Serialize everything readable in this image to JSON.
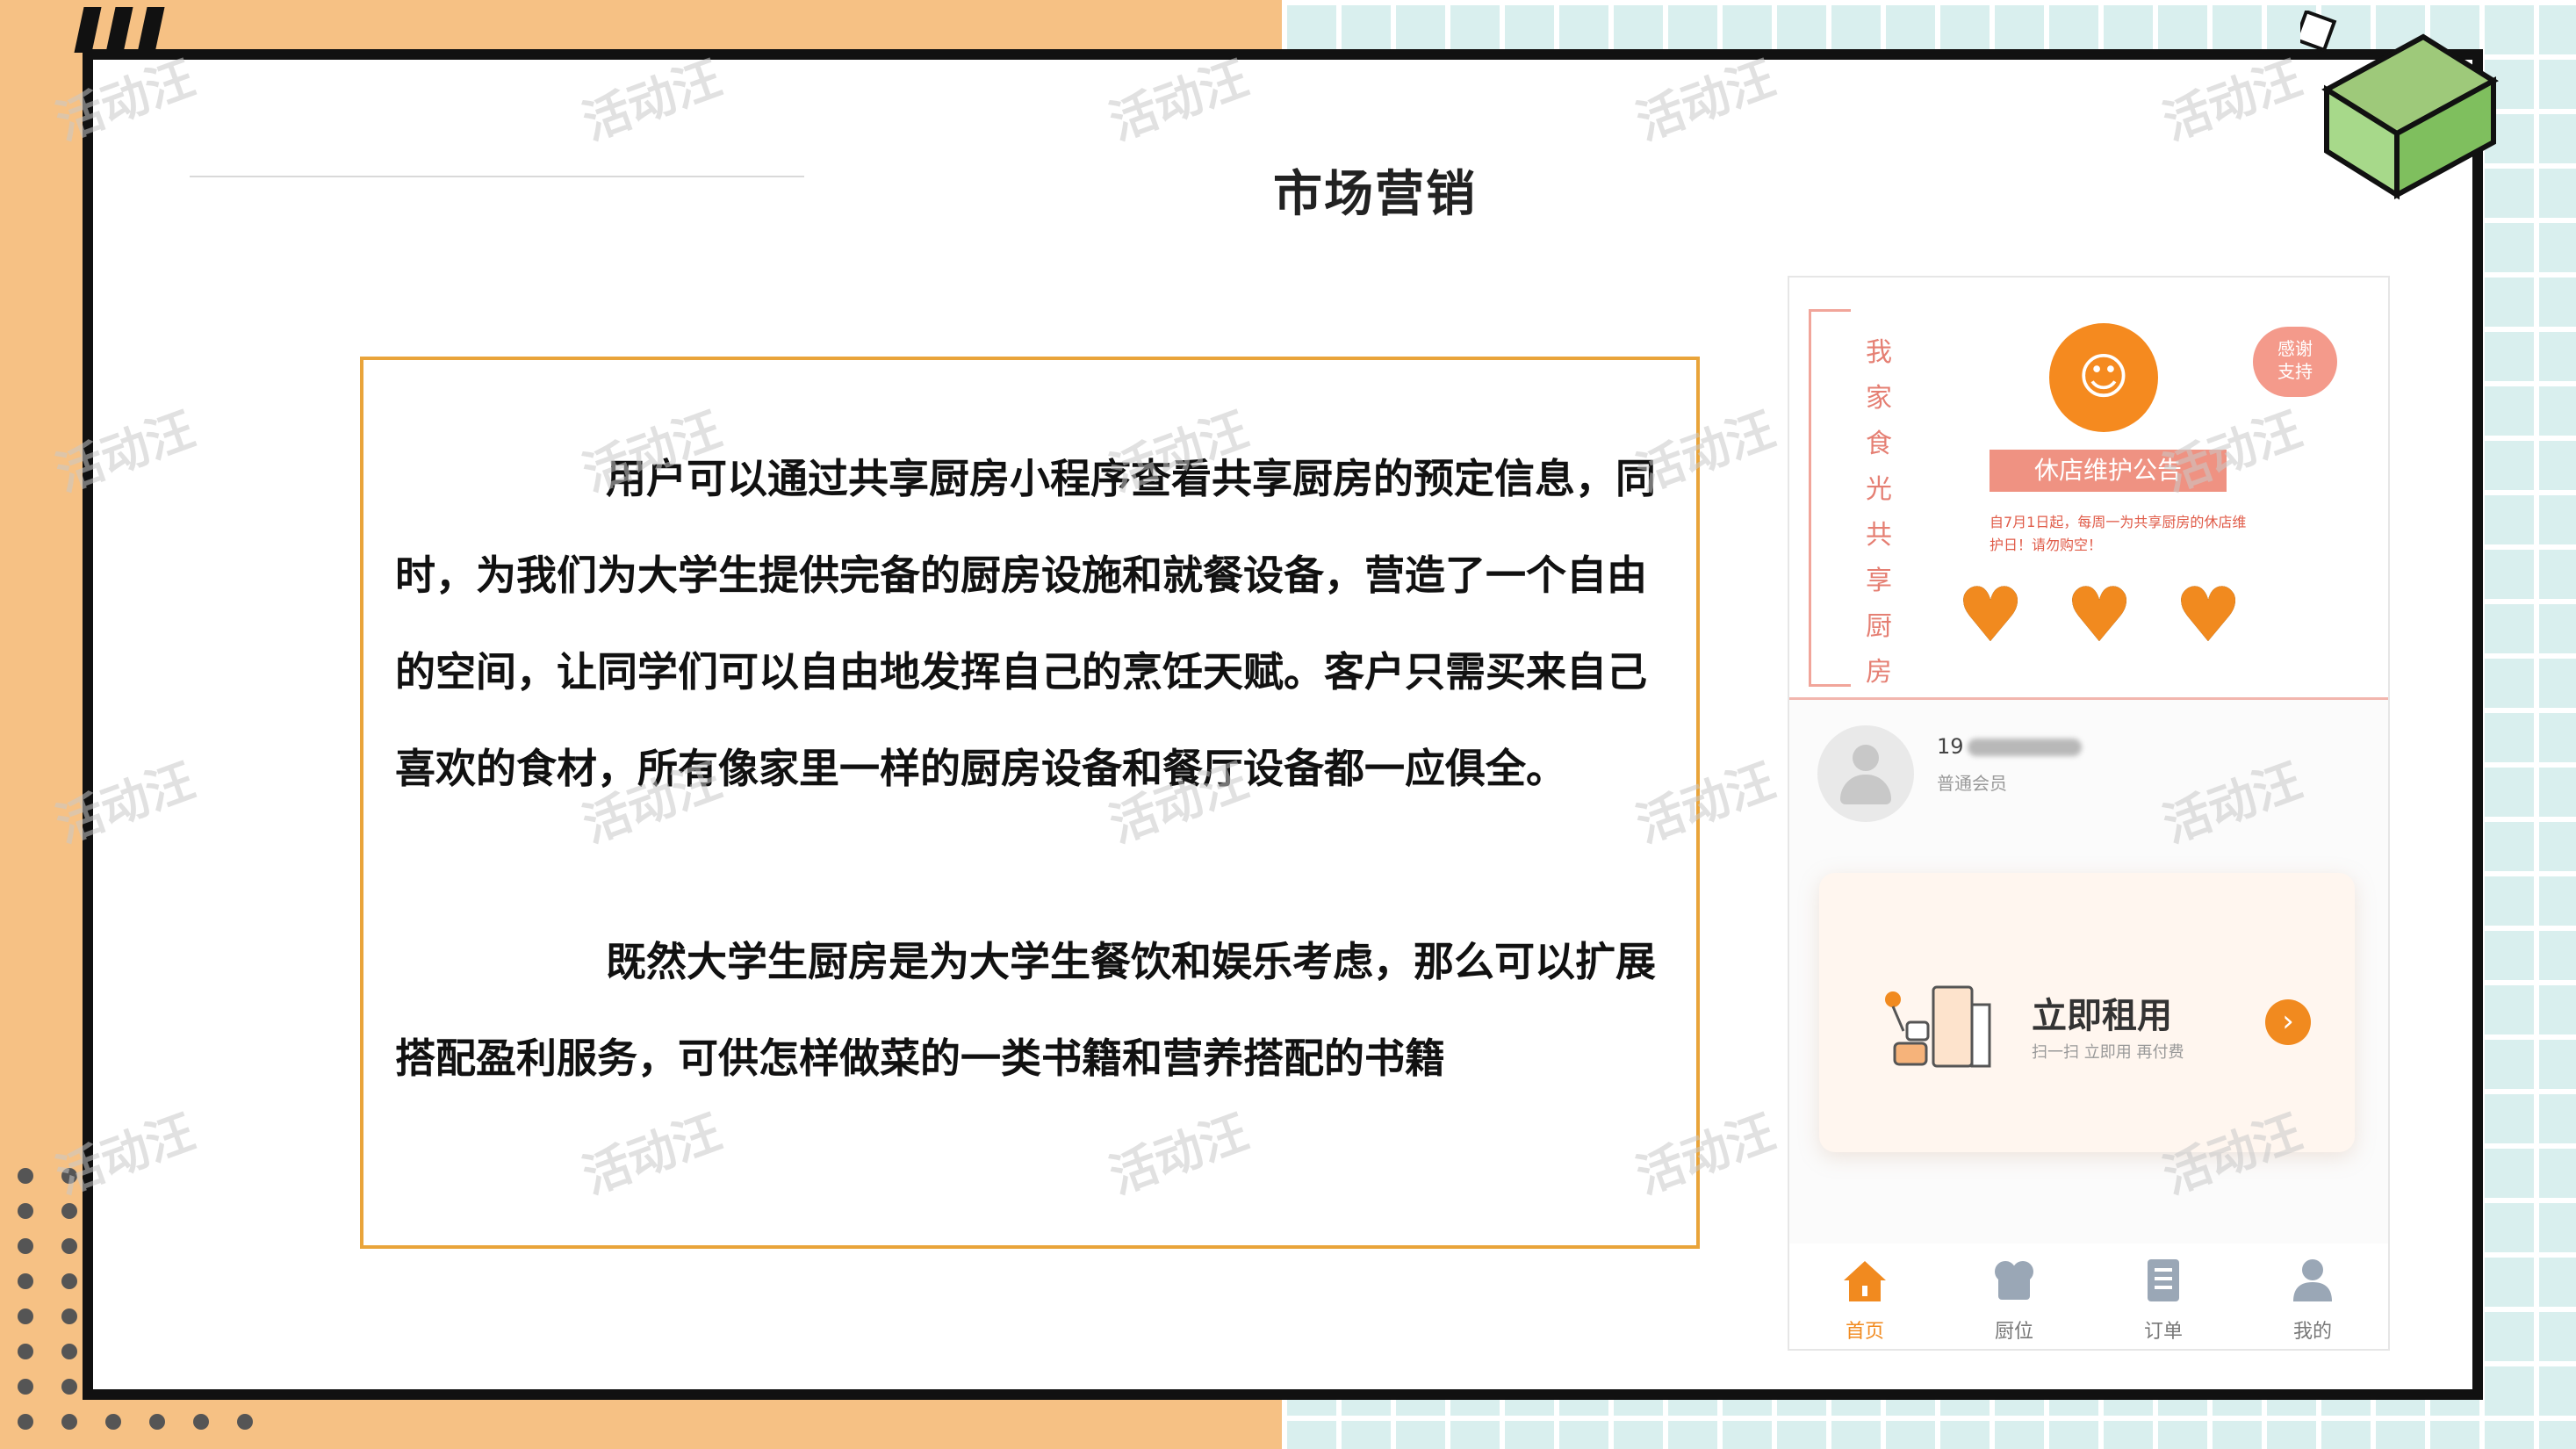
{
  "slide": {
    "title": "市场营销",
    "paragraphs": [
      "用户可以通过共享厨房小程序查看共享厨房的预定信息，同时，为我们为大学生提供完备的厨房设施和就餐设备，营造了一个自由的空间，让同学们可以自由地发挥自己的烹饪天赋。客户只需买来自己喜欢的食材，所有像家里一样的厨房设备和餐厅设备都一应俱全。",
      "既然大学生厨房是为大学生餐饮和娱乐考虑，那么可以扩展搭配盈利服务，可供怎样做菜的一类书籍和营养搭配的书籍"
    ],
    "watermark": "活动汪"
  },
  "phone": {
    "banner": {
      "vertical_text": "我家食光共享厨房",
      "thanks_label": "感谢\n支持",
      "notice_title": "休店维护公告",
      "notice_body": "自7月1日起，每周一为共享厨房的休店维护日！请勿购空！"
    },
    "user": {
      "phone_prefix": "19",
      "member_level": "普通会员"
    },
    "rent": {
      "title": "立即租用",
      "subtitle": "扫一扫 立即用 再付费"
    },
    "tabs": [
      {
        "label": "首页",
        "icon": "home-icon"
      },
      {
        "label": "厨位",
        "icon": "chef-hat-icon"
      },
      {
        "label": "订单",
        "icon": "order-icon"
      },
      {
        "label": "我的",
        "icon": "user-icon"
      }
    ]
  },
  "colors": {
    "accent": "#f18a1f",
    "frame": "#e9a43a",
    "bg_left": "#f6c184",
    "bg_right": "#d9efee"
  }
}
